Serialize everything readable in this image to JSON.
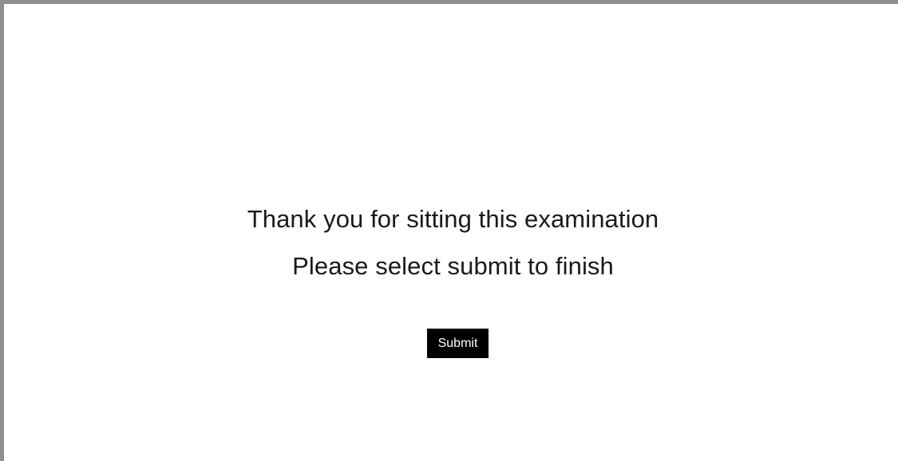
{
  "completion": {
    "message_line_1": "Thank you for sitting this examination",
    "message_line_2": "Please select submit to finish",
    "submit_label": "Submit"
  },
  "colors": {
    "frame_border": "#8f8f8f",
    "background": "#ffffff",
    "button_background": "#000000",
    "button_text": "#ffffff",
    "text": "#1a1a1a"
  }
}
